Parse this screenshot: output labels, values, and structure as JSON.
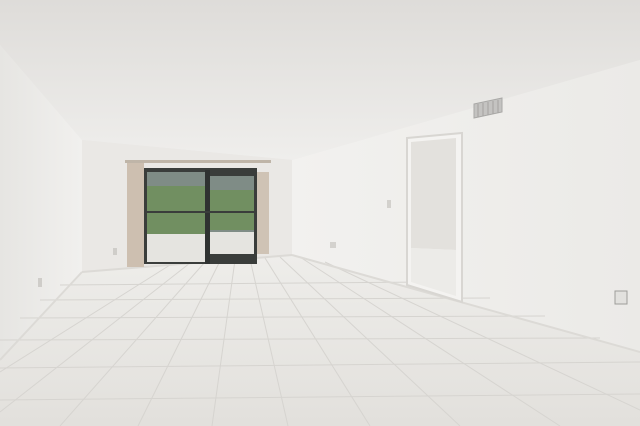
{
  "scene": {
    "subject": "empty-room",
    "elements": [
      "textured-ceiling",
      "sliding-glass-door",
      "curtains",
      "open-doorway",
      "hvac-vent",
      "wall-outlets",
      "tile-floor"
    ]
  },
  "colors": {
    "ceiling": "#e7e6e4",
    "wall_left": "#eeedeb",
    "wall_back": "#ebe9e6",
    "wall_right": "#efeeec",
    "floor": "#e9e8e4",
    "grout": "#d5d3cf",
    "curtain": "#cdbfb0",
    "glass": "#7f8c86",
    "foliage": "#6f8f5a",
    "frame": "#3a3d3b",
    "vent": "#bdbcba"
  }
}
